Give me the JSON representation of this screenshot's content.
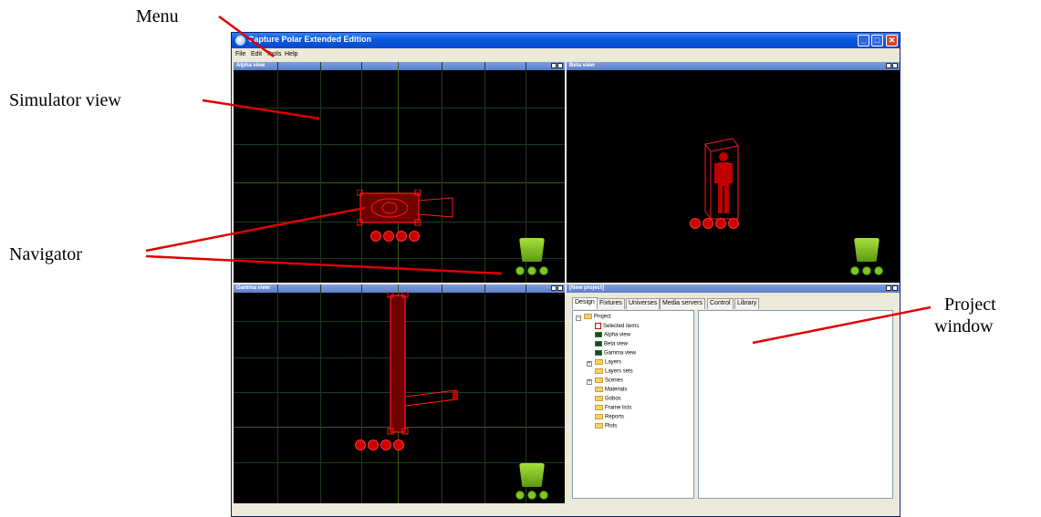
{
  "callouts": {
    "menu": "Menu",
    "simulator_view": "Simulator view",
    "navigator": "Navigator",
    "project_window_line1": "Project",
    "project_window_line2": "window"
  },
  "window": {
    "title": "Capture Polar Extended Edition",
    "buttons": {
      "minimize": "_",
      "maximize": "□",
      "close": "✕"
    }
  },
  "menu": [
    "File",
    "Edit",
    "Tools",
    "Help"
  ],
  "panes": {
    "alpha": "Alpha view",
    "beta": "Beta view",
    "gamma": "Gamma view",
    "project": "[New project]"
  },
  "project": {
    "tabs": [
      "Design",
      "Fixtures",
      "Universes",
      "Media servers",
      "Control",
      "Library"
    ],
    "active_tab": "Design",
    "tree": [
      {
        "label": "Project",
        "icon": "folder-icon",
        "expander": "−"
      },
      {
        "label": "Selected items",
        "icon": "selection-icon"
      },
      {
        "label": "Alpha view",
        "icon": "view-icon"
      },
      {
        "label": "Beta view",
        "icon": "view-icon"
      },
      {
        "label": "Gamma view",
        "icon": "view-icon"
      },
      {
        "label": "Layers",
        "icon": "folder-icon",
        "expander": "+"
      },
      {
        "label": "Layers sets",
        "icon": "folder-icon"
      },
      {
        "label": "Scenes",
        "icon": "folder-icon",
        "expander": "+"
      },
      {
        "label": "Materials",
        "icon": "folder-icon"
      },
      {
        "label": "Gobos",
        "icon": "folder-icon"
      },
      {
        "label": "Frame lists",
        "icon": "folder-icon"
      },
      {
        "label": "Reports",
        "icon": "folder-icon"
      },
      {
        "label": "Plots",
        "icon": "folder-icon"
      }
    ]
  },
  "colors": {
    "viewport_bg": "#000000",
    "fixture_red": "#e00000",
    "navigator_green": "#7ec820",
    "callout_line": "#e00000"
  }
}
